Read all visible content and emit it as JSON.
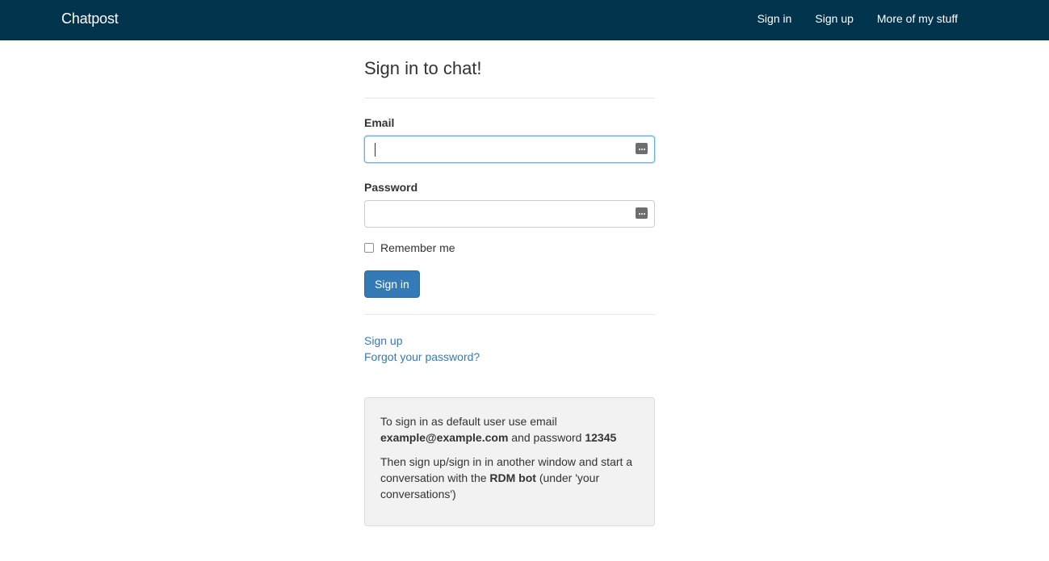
{
  "navbar": {
    "brand": "Chatpost",
    "links": [
      "Sign in",
      "Sign up",
      "More of my stuff"
    ]
  },
  "form": {
    "title": "Sign in to chat!",
    "email_label": "Email",
    "email_value": "",
    "password_label": "Password",
    "password_value": "",
    "remember_label": "Remember me",
    "remember_checked": false,
    "submit_label": "Sign in"
  },
  "links": {
    "sign_up": "Sign up",
    "forgot_password": "Forgot your password?"
  },
  "info": {
    "line1_pre": "To sign in as default user use email ",
    "email": "example@example.com",
    "line1_mid": " and password ",
    "password": "12345",
    "line2_pre": "Then sign up/sign in in another window and start a conversation with the ",
    "bot": "RDM bot",
    "line2_post": " (under 'your conversations')"
  },
  "colors": {
    "navbar_bg": "#02344e",
    "primary": "#337ab7",
    "well_bg": "#f2f2f2"
  }
}
